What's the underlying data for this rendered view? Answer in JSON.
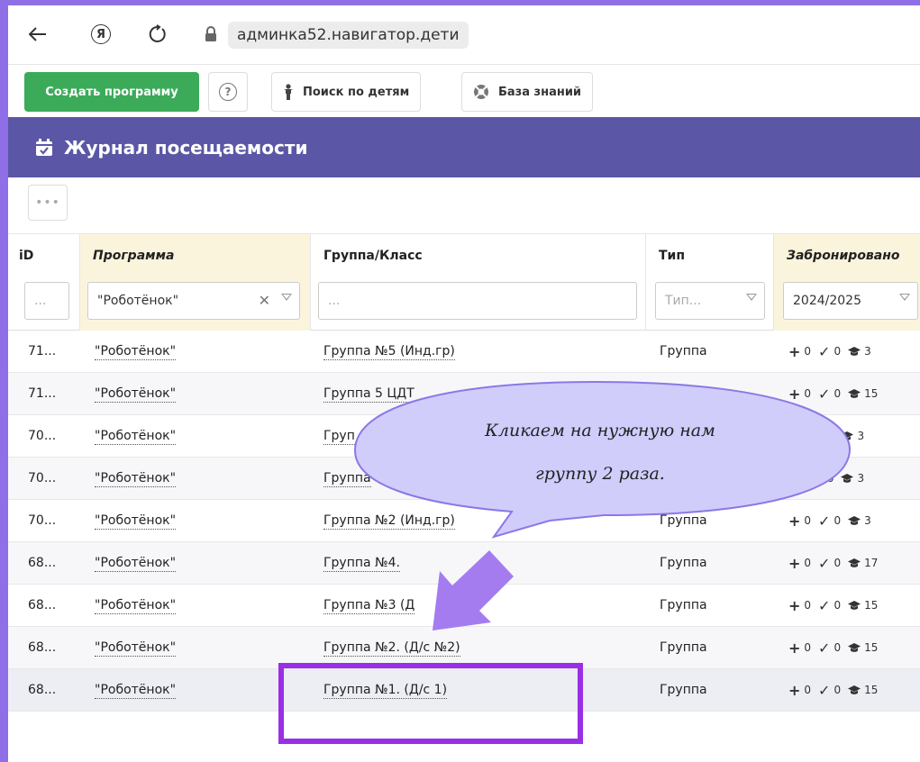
{
  "browser": {
    "url": "админка52.навигатор.дети",
    "icons": [
      "back-arrow-icon",
      "yandex-icon",
      "reload-icon",
      "lock-icon"
    ]
  },
  "toolbar": {
    "create_label": "Создать программу",
    "help_glyph": "?",
    "search_children_label": "Поиск по детям",
    "knowledge_base_label": "База знаний"
  },
  "header": {
    "title": "Журнал посещаемости"
  },
  "more_glyph": "•••",
  "table": {
    "columns": {
      "id": "iD",
      "program": "Программа",
      "group": "Группа/Класс",
      "type": "Тип",
      "booked": "Забронировано"
    },
    "filters": {
      "id_placeholder": "...",
      "program_value": "\"Роботёнок\"",
      "group_placeholder": "...",
      "type_placeholder": "Тип...",
      "booked_value": "2024/2025"
    },
    "rows": [
      {
        "id": "71...",
        "program": "\"Роботёнок\"",
        "group": "Группа №5 (Инд.гр)",
        "type": "Группа",
        "plus": "0",
        "check": "0",
        "cap": "3"
      },
      {
        "id": "71...",
        "program": "\"Роботёнок\"",
        "group": "Группа 5 ЦДТ",
        "type": "Группа",
        "plus": "0",
        "check": "0",
        "cap": "15"
      },
      {
        "id": "70...",
        "program": "\"Роботёнок\"",
        "group": "Груп",
        "type": "",
        "plus": "",
        "check": "0",
        "cap": "3"
      },
      {
        "id": "70...",
        "program": "\"Роботёнок\"",
        "group": "Группа",
        "type": "",
        "plus": "",
        "check": "0",
        "cap": "3"
      },
      {
        "id": "70...",
        "program": "\"Роботёнок\"",
        "group": "Группа №2 (Инд.гр)",
        "type": "Группа",
        "plus": "0",
        "check": "0",
        "cap": "3"
      },
      {
        "id": "68...",
        "program": "\"Роботёнок\"",
        "group": "Группа №4.",
        "type": "Группа",
        "plus": "0",
        "check": "0",
        "cap": "17"
      },
      {
        "id": "68...",
        "program": "\"Роботёнок\"",
        "group": "Группа №3 (Д",
        "type": "Группа",
        "plus": "0",
        "check": "0",
        "cap": "15"
      },
      {
        "id": "68...",
        "program": "\"Роботёнок\"",
        "group": "Группа №2. (Д/с №2)",
        "type": "Группа",
        "plus": "0",
        "check": "0",
        "cap": "15"
      },
      {
        "id": "68...",
        "program": "\"Роботёнок\"",
        "group": "Группа №1. (Д/с 1)",
        "type": "Группа",
        "plus": "0",
        "check": "0",
        "cap": "15"
      }
    ]
  },
  "annotation": {
    "line1": "Кликаем на нужную нам",
    "line2": "группу 2 раза.",
    "bubble_color": "#d0cdfb",
    "bubble_border": "#8b78e6",
    "arrow_color": "#a57cf0",
    "box_color": "#9a2fe6"
  }
}
